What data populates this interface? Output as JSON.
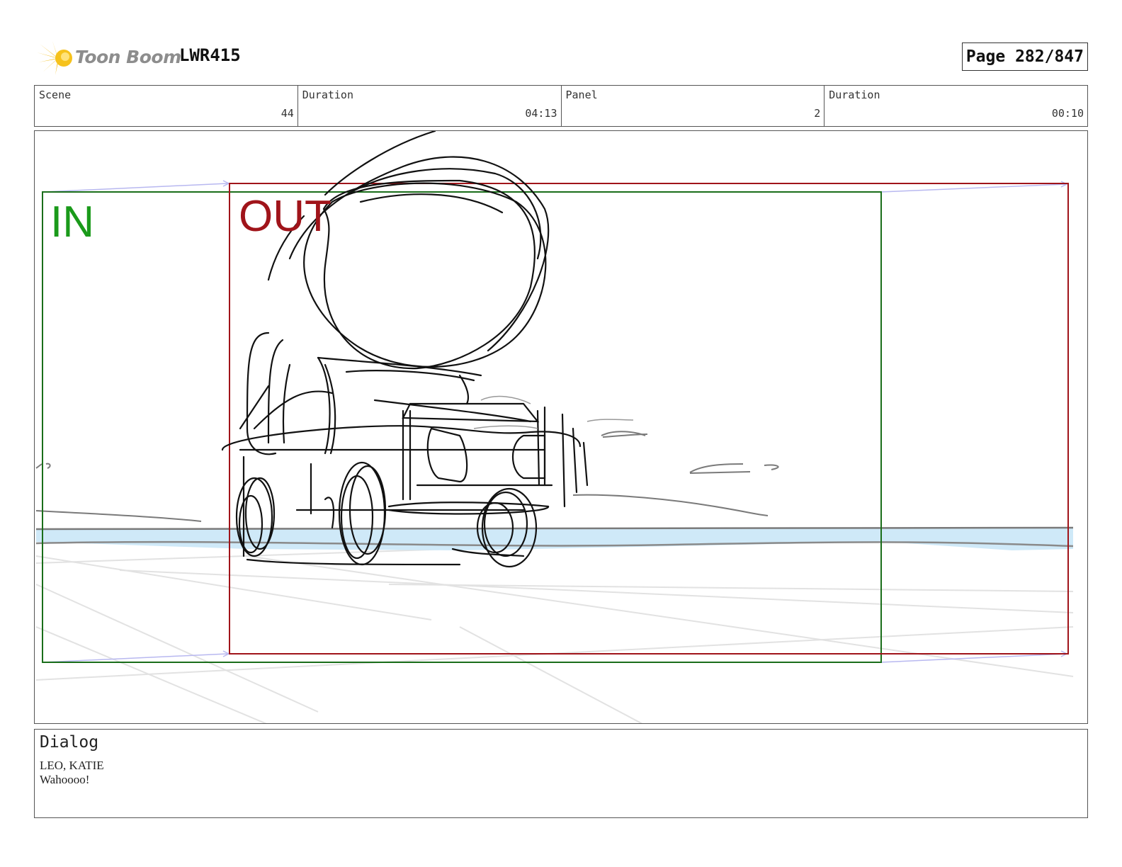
{
  "header": {
    "logo_text": "Toon Boom",
    "project_code": "LWR415",
    "page_label": "Page 282/847"
  },
  "info": {
    "scene_label": "Scene",
    "scene_value": "44",
    "scene_duration_label": "Duration",
    "scene_duration_value": "04:13",
    "panel_label": "Panel",
    "panel_value": "2",
    "panel_duration_label": "Duration",
    "panel_duration_value": "00:10"
  },
  "frame": {
    "in_label": "IN",
    "out_label": "OUT",
    "in_color": "#1a7a1a",
    "out_color": "#a0141a",
    "water_color": "#cfe9f8"
  },
  "dialog": {
    "title": "Dialog",
    "speaker": "LEO, KATIE",
    "line": "Wahoooo!"
  }
}
